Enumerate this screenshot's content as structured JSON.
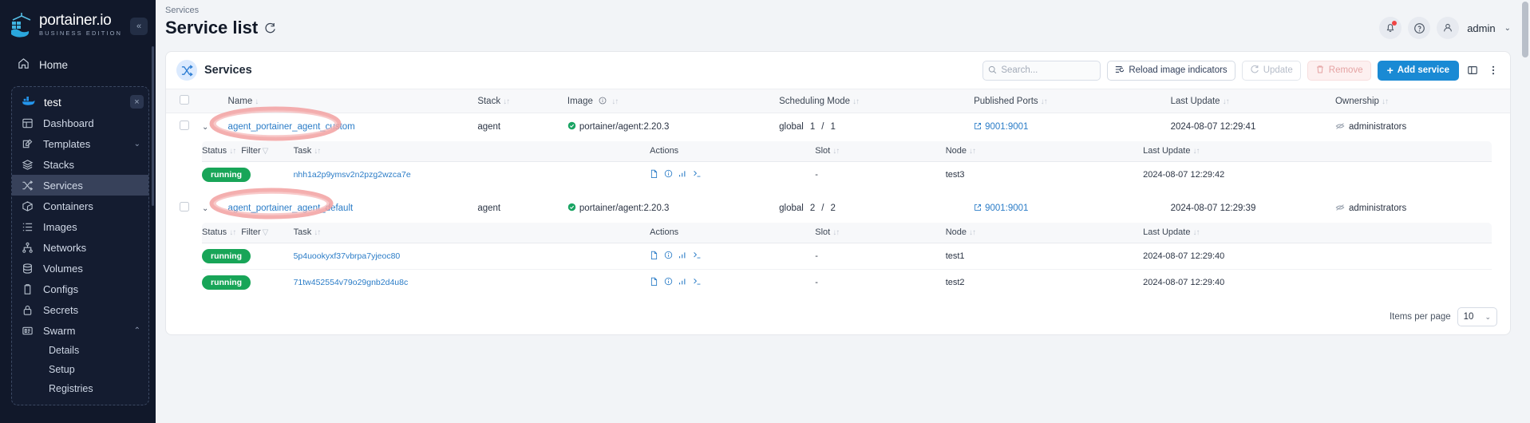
{
  "sidebar": {
    "logo": {
      "title": "portainer.io",
      "subtitle": "BUSINESS EDITION",
      "icon": "portainer-logo-icon"
    },
    "collapse_label": "«",
    "home": {
      "label": "Home",
      "icon": "home-icon"
    },
    "environment": {
      "name": "test",
      "icon": "docker-whale-icon",
      "close_label": "×"
    },
    "items": [
      {
        "label": "Dashboard",
        "icon": "dashboard-icon",
        "active": false,
        "chevron": ""
      },
      {
        "label": "Templates",
        "icon": "templates-icon",
        "active": false,
        "chevron": "⌄"
      },
      {
        "label": "Stacks",
        "icon": "stacks-icon",
        "active": false,
        "chevron": ""
      },
      {
        "label": "Services",
        "icon": "services-icon",
        "active": true,
        "chevron": ""
      },
      {
        "label": "Containers",
        "icon": "containers-icon",
        "active": false,
        "chevron": ""
      },
      {
        "label": "Images",
        "icon": "images-icon",
        "active": false,
        "chevron": ""
      },
      {
        "label": "Networks",
        "icon": "networks-icon",
        "active": false,
        "chevron": ""
      },
      {
        "label": "Volumes",
        "icon": "volumes-icon",
        "active": false,
        "chevron": ""
      },
      {
        "label": "Configs",
        "icon": "configs-icon",
        "active": false,
        "chevron": ""
      },
      {
        "label": "Secrets",
        "icon": "secrets-icon",
        "active": false,
        "chevron": ""
      },
      {
        "label": "Swarm",
        "icon": "swarm-icon",
        "active": false,
        "chevron": "⌃"
      }
    ],
    "sub_items": [
      {
        "label": "Details"
      },
      {
        "label": "Setup"
      },
      {
        "label": "Registries"
      }
    ]
  },
  "header": {
    "breadcrumb": "Services",
    "title": "Service list",
    "refresh_icon": "refresh-icon",
    "notification_icon": "bell-icon",
    "help_icon": "help-circle-icon",
    "user_icon": "user-icon",
    "user_name": "admin",
    "caret": "⌄"
  },
  "card": {
    "title": "Services",
    "icon": "shuffle-icon",
    "search": {
      "placeholder": "Search...",
      "value": "",
      "icon": "search-icon",
      "clear": "×"
    },
    "buttons": {
      "reload": {
        "label": "Reload image indicators",
        "icon": "reload-indicators-icon",
        "disabled": false
      },
      "update": {
        "label": "Update",
        "icon": "update-icon",
        "disabled": true
      },
      "remove": {
        "label": "Remove",
        "icon": "trash-icon",
        "disabled": true
      },
      "add": {
        "label": "Add service",
        "icon": "plus-icon",
        "disabled": false
      }
    },
    "columns_icon": "columns-icon",
    "kebab_icon": "kebab-menu-icon"
  },
  "table": {
    "headers": [
      {
        "label": "Name",
        "sort": "↓"
      },
      {
        "label": "Stack",
        "sort": "↓↑"
      },
      {
        "label": "Image",
        "sort": "↓↑",
        "info_icon": "info-icon"
      },
      {
        "label": "Scheduling Mode",
        "sort": "↓↑"
      },
      {
        "label": "Published Ports",
        "sort": "↓↑"
      },
      {
        "label": "Last Update",
        "sort": "↓↑"
      },
      {
        "label": "Ownership",
        "sort": "↓↑"
      }
    ],
    "nested_headers": [
      {
        "label": "Status",
        "sort": "↓↑"
      },
      {
        "label": "Filter",
        "icon": "filter-icon"
      },
      {
        "label": "Task",
        "sort": "↓↑"
      },
      {
        "label": "Actions"
      },
      {
        "label": "Slot",
        "sort": "↓↑"
      },
      {
        "label": "Node",
        "sort": "↓↑"
      },
      {
        "label": "Last Update",
        "sort": "↓↑"
      }
    ],
    "rows": [
      {
        "name": "agent_portainer_agent_custom",
        "stack": "agent",
        "image": "portainer/agent:2.20.3",
        "image_status_icon": "check-circle-icon",
        "scheduling_mode": "global",
        "running": "1",
        "separator": "/",
        "total": "1",
        "published_ports": "9001:9001",
        "port_icon": "external-link-icon",
        "last_update": "2024-08-07 12:29:41",
        "ownership": "administrators",
        "ownership_icon": "eye-off-icon",
        "expanded": true,
        "annotated": true,
        "tasks": [
          {
            "status": "running",
            "task": "nhh1a2p9ymsv2n2pzg2wzca7e",
            "actions": [
              "logs-icon",
              "inspect-icon",
              "stats-icon",
              "console-icon"
            ],
            "slot": "-",
            "node": "test3",
            "last_update": "2024-08-07 12:29:42"
          }
        ]
      },
      {
        "name": "agent_portainer_agent_default",
        "stack": "agent",
        "image": "portainer/agent:2.20.3",
        "image_status_icon": "check-circle-icon",
        "scheduling_mode": "global",
        "running": "2",
        "separator": "/",
        "total": "2",
        "published_ports": "9001:9001",
        "port_icon": "external-link-icon",
        "last_update": "2024-08-07 12:29:39",
        "ownership": "administrators",
        "ownership_icon": "eye-off-icon",
        "expanded": true,
        "annotated": true,
        "tasks": [
          {
            "status": "running",
            "task": "5p4uookyxf37vbrpa7yjeoc80",
            "actions": [
              "logs-icon",
              "inspect-icon",
              "stats-icon",
              "console-icon"
            ],
            "slot": "-",
            "node": "test1",
            "last_update": "2024-08-07 12:29:40"
          },
          {
            "status": "running",
            "task": "71tw452554v79o29gnb2d4u8c",
            "actions": [
              "logs-icon",
              "inspect-icon",
              "stats-icon",
              "console-icon"
            ],
            "slot": "-",
            "node": "test2",
            "last_update": "2024-08-07 12:29:40"
          }
        ]
      }
    ]
  },
  "footer": {
    "items_per_page_label": "Items per page",
    "items_per_page_value": "10",
    "caret": "⌄"
  },
  "colors": {
    "sidebar_bg": "#11182a",
    "accent_blue": "#1a8ad4",
    "link_blue": "#2a7cc7",
    "running_green": "#18a558",
    "annotation_red": "#f08a8a"
  }
}
